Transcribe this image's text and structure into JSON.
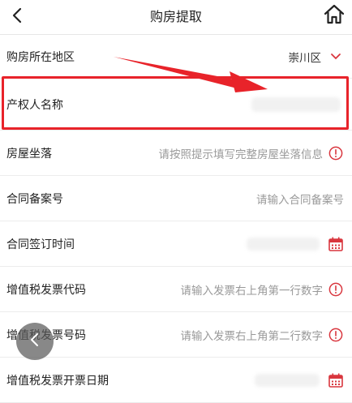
{
  "header": {
    "title": "购房提取",
    "back_icon": "back-arrow-icon",
    "home_icon": "home-icon"
  },
  "form": {
    "region": {
      "label": "购房所在地区",
      "value": "崇川区",
      "icon": "chevron-down-icon"
    },
    "owner_name": {
      "label": "产权人名称",
      "value": ""
    },
    "house_location": {
      "label": "房屋坐落",
      "placeholder": "请按照提示填写完整房屋坐落信息",
      "icon": "info-alert-icon"
    },
    "contract_record_no": {
      "label": "合同备案号",
      "placeholder": "请输入合同备案号"
    },
    "contract_sign_date": {
      "label": "合同签订时间",
      "value": "",
      "icon": "calendar-icon"
    },
    "vat_invoice_code": {
      "label": "增值税发票代码",
      "placeholder": "请输入发票右上角第一行数字",
      "icon": "info-alert-icon"
    },
    "vat_invoice_number": {
      "label": "增值税发票号码",
      "placeholder": "请输入发票右上角第二行数字",
      "icon": "info-alert-icon"
    },
    "vat_invoice_date": {
      "label": "增值税发票开票日期",
      "value": "",
      "icon": "calendar-icon"
    }
  },
  "colors": {
    "accent_red": "#e8232a",
    "icon_red": "#d9363e",
    "placeholder": "#999999",
    "divider": "#ececec"
  },
  "floating": {
    "back_icon": "chevron-left-icon"
  }
}
